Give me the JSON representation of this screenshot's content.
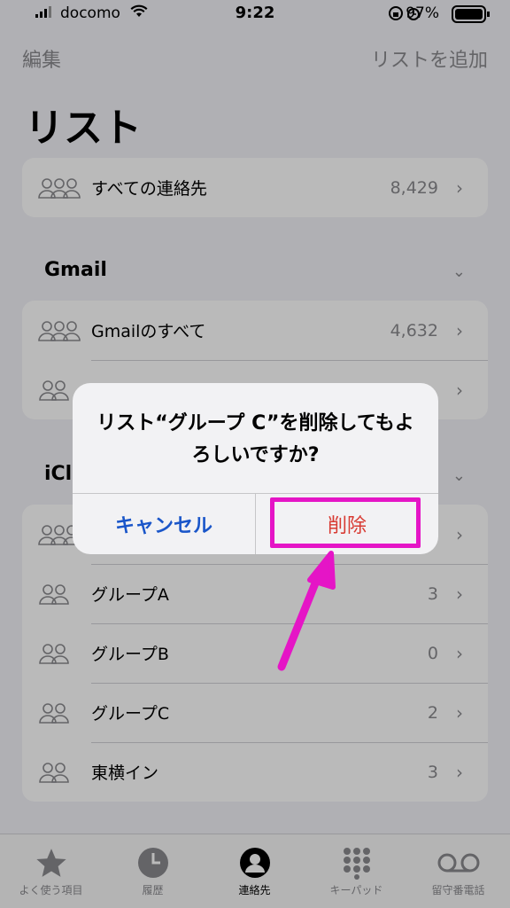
{
  "status_bar": {
    "carrier": "docomo",
    "time": "9:22",
    "battery": "97%"
  },
  "nav": {
    "edit": "編集",
    "add_list": "リストを追加"
  },
  "page_title": "リスト",
  "all_contacts": {
    "label": "すべての連絡先",
    "count": "8,429"
  },
  "gmail": {
    "header": "Gmail",
    "rows": [
      {
        "label": "Gmailのすべて",
        "count": "4,632"
      },
      {
        "label": "",
        "count": ""
      }
    ]
  },
  "icloud": {
    "header": "iCl",
    "rows": [
      {
        "label": "",
        "count": ""
      },
      {
        "label": "グループA",
        "count": "3"
      },
      {
        "label": "グループB",
        "count": "0"
      },
      {
        "label": "グループC",
        "count": "2"
      },
      {
        "label": "東横イン",
        "count": "3"
      }
    ]
  },
  "alert": {
    "message": "リスト“グループ C”を削除してもよろしいですか?",
    "cancel": "キャンセル",
    "delete": "削除"
  },
  "tabs": [
    {
      "label": "よく使う項目",
      "icon": "star-icon"
    },
    {
      "label": "履歴",
      "icon": "clock-icon"
    },
    {
      "label": "連絡先",
      "icon": "person-circle-icon"
    },
    {
      "label": "キーパッド",
      "icon": "keypad-icon"
    },
    {
      "label": "留守番電話",
      "icon": "voicemail-icon"
    }
  ],
  "colors": {
    "accent": "#1a56c9",
    "destructive": "#d83a32",
    "highlight": "#e515c6",
    "arrow": "#e515c6"
  }
}
